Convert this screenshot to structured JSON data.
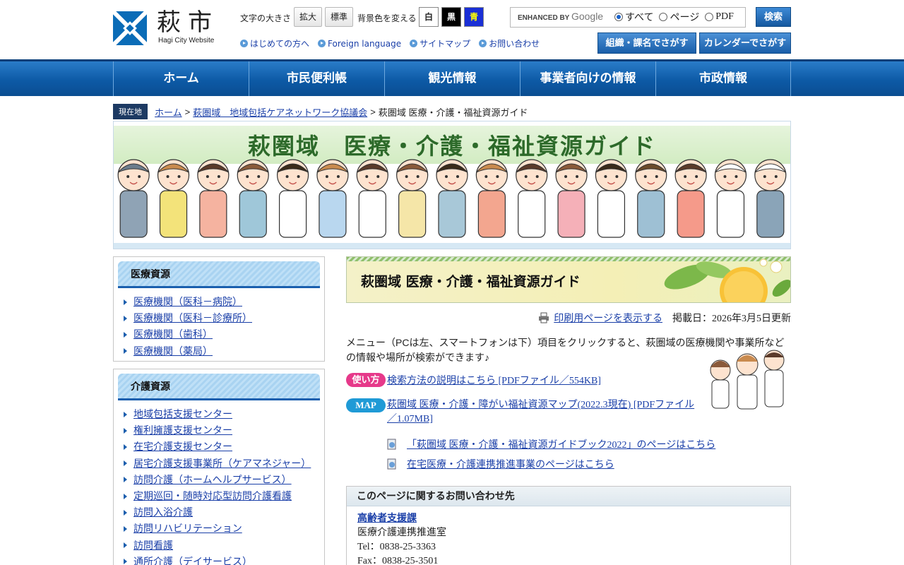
{
  "header": {
    "logo_text": "萩市",
    "logo_sub": "Hagi City Website",
    "font_size_label": "文字の大きさ",
    "font_larger": "拡大",
    "font_standard": "標準",
    "bg_label": "背景色を変える",
    "bg_white": "白",
    "bg_black": "黒",
    "bg_blue": "青",
    "search_brand_prefix": "ENHANCED BY",
    "search_brand_name": "Google",
    "radio_all": "すべて",
    "radio_page": "ページ",
    "radio_pdf": "PDF",
    "search_button": "検索",
    "links": [
      "はじめての方へ",
      "Foreign language",
      "サイトマップ",
      "お問い合わせ"
    ],
    "btn_org": "組織・課名でさがす",
    "btn_calendar": "カレンダーでさがす"
  },
  "nav": [
    "ホーム",
    "市民便利帳",
    "観光情報",
    "事業者向けの情報",
    "市政情報"
  ],
  "breadcrumb": {
    "tag": "現在地",
    "home": "ホーム",
    "parent": "萩圏域　地域包括ケアネットワーク協議会",
    "current": "萩圏域 医療・介護・福祉資源ガイド"
  },
  "banner": {
    "title": "萩圏域　医療・介護・福祉資源ガイド"
  },
  "sidebar": {
    "medical": {
      "title": "医療資源",
      "items": [
        "医療機関（医科－病院）",
        "医療機関（医科－診療所）",
        "医療機関（歯科）",
        "医療機関（薬局）"
      ]
    },
    "care": {
      "title": "介護資源",
      "items": [
        "地域包括支援センター",
        "権利擁護支援センター",
        "在宅介護支援センター",
        "居宅介護支援事業所（ケアマネジャー）",
        "訪問介護（ホームヘルプサービス）",
        "定期巡回・随時対応型訪問介護看護",
        "訪問入浴介護",
        "訪問リハビリテーション",
        "訪問看護",
        "通所介護（デイサービス）"
      ]
    }
  },
  "main": {
    "title": "萩圏域 医療・介護・福祉資源ガイド",
    "print_link": "印刷用ページを表示する",
    "updated": "掲載日：2026年3月5日更新",
    "intro": "メニュー（PCは左、スマートフォンは下）項目をクリックすると、萩圏域の医療機関や事業所などの情報や場所が検索ができます♪",
    "badge_howto": "使い方",
    "howto_link": "検索方法の説明はこちら [PDFファイル／554KB]",
    "badge_map": "MAP",
    "map_link": "萩圏域 医療・介護・障がい福祉資源マップ(2022.3現在)  [PDFファイル／1.07MB]",
    "doc_links": [
      "「萩圏域 医療・介護・福祉資源ガイドブック2022」のページはこちら",
      "在宅医療・介護連携推進事業のページはこちら"
    ]
  },
  "contact": {
    "heading": "このページに関するお問い合わせ先",
    "dept": "高齢者支援課",
    "office": "医療介護連携推進室",
    "tel": "Tel：0838-25-3363",
    "fax": "Fax：0838-25-3501"
  },
  "colors": {
    "nav_blue": "#0d5aa6",
    "link": "#1a3fa8",
    "badge_pink": "#e6398a",
    "badge_blue": "#1f9ad6"
  }
}
